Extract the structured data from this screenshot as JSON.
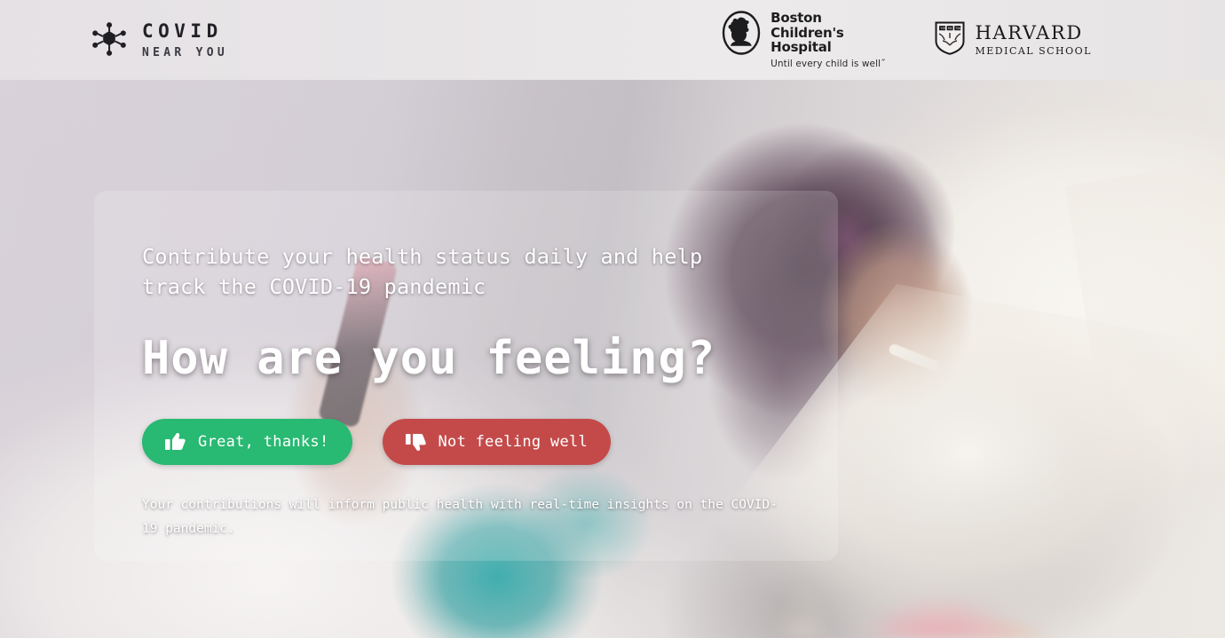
{
  "header": {
    "brand": {
      "icon": "virus-icon",
      "title": "COVID",
      "subtitle": "NEAR YOU"
    },
    "partners": [
      {
        "icon": "boston-childrens-hospital-crest-icon",
        "name_line1": "Boston",
        "name_line2": "Children's",
        "name_line3": "Hospital",
        "tagline": "Until every child is well˝"
      },
      {
        "icon": "harvard-shield-icon",
        "name": "HARVARD",
        "subtitle": "MEDICAL SCHOOL"
      }
    ]
  },
  "hero": {
    "kicker": "Contribute your health status daily and help track the COVID-19 pandemic",
    "title": "How are you feeling?",
    "buttons": {
      "positive": {
        "icon": "thumbs-up-icon",
        "label": "Great, thanks!",
        "color": "#28b972"
      },
      "negative": {
        "icon": "thumbs-down-icon",
        "label": "Not feeling well",
        "color": "#c44a4a"
      }
    },
    "note": "Your contributions will inform public health with real-time insights on the COVID-19 pandemic."
  },
  "colors": {
    "header_background": "#e8e5e8",
    "card_overlay": "rgba(255,255,255,0.17)",
    "positive": "#28b972",
    "negative": "#c44a4a",
    "brand_text": "#222126"
  }
}
